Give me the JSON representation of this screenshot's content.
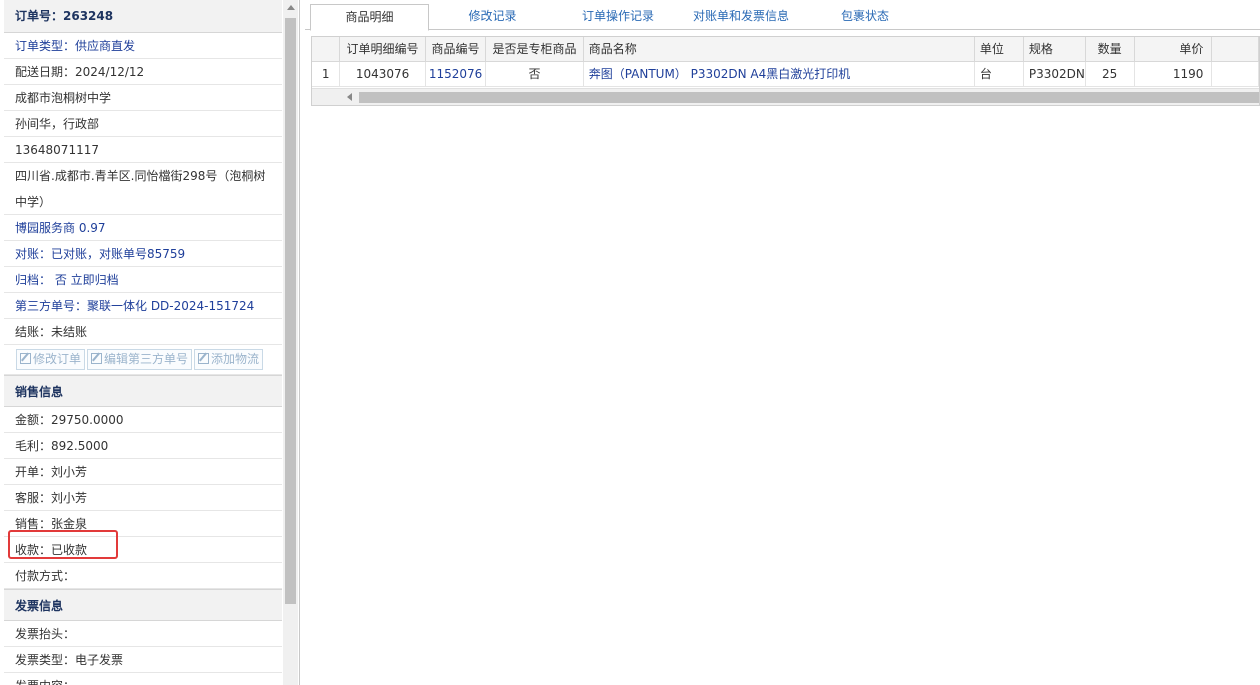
{
  "order": {
    "title": "订单号：263248",
    "type": "订单类型：供应商直发",
    "delivery_date": "配送日期：2024/12/12",
    "school": "成都市泡桐树中学",
    "contact": "孙间华，行政部",
    "phone": "13648071117",
    "address": "四川省.成都市.青羊区.同怡檔街298号（泡桐树中学）",
    "service": "博园服务商 0.97",
    "reconcile": "对账：已对账，对账单号85759",
    "archive": "归档： 否 立即归档",
    "third_party": "第三方单号：聚联一体化 DD-2024-151724",
    "settlement": "结账：未结账"
  },
  "actions": {
    "edit_order": "修改订单",
    "edit_third_party": "编辑第三方单号",
    "add_logistics": "添加物流"
  },
  "sales": {
    "header": "销售信息",
    "amount": "金额：29750.0000",
    "profit": "毛利：892.5000",
    "issuer": "开单：刘小芳",
    "service_staff": "客服：刘小芳",
    "salesperson": "销售：张金泉",
    "payment_status": "收款：已收款",
    "payment_method": "付款方式："
  },
  "invoice": {
    "header": "发票信息",
    "title": "发票抬头：",
    "type": "发票类型：电子发票",
    "content": "发票内容："
  },
  "tabs": [
    "商品明细",
    "修改记录",
    "订单操作记录",
    "对账单和发票信息",
    "包裹状态"
  ],
  "grid": {
    "columns": [
      "订单明细编号",
      "商品编号",
      "是否是专柜商品",
      "商品名称",
      "单位",
      "规格",
      "数量",
      "单价"
    ],
    "rows": [
      {
        "index": "1",
        "detail_id": "1043076",
        "product_id": "1152076",
        "counter": "否",
        "name": "奔图（PANTUM） P3302DN A4黑白激光打印机",
        "unit": "台",
        "spec": "P3302DN",
        "qty": "25",
        "price": "1190"
      }
    ]
  }
}
